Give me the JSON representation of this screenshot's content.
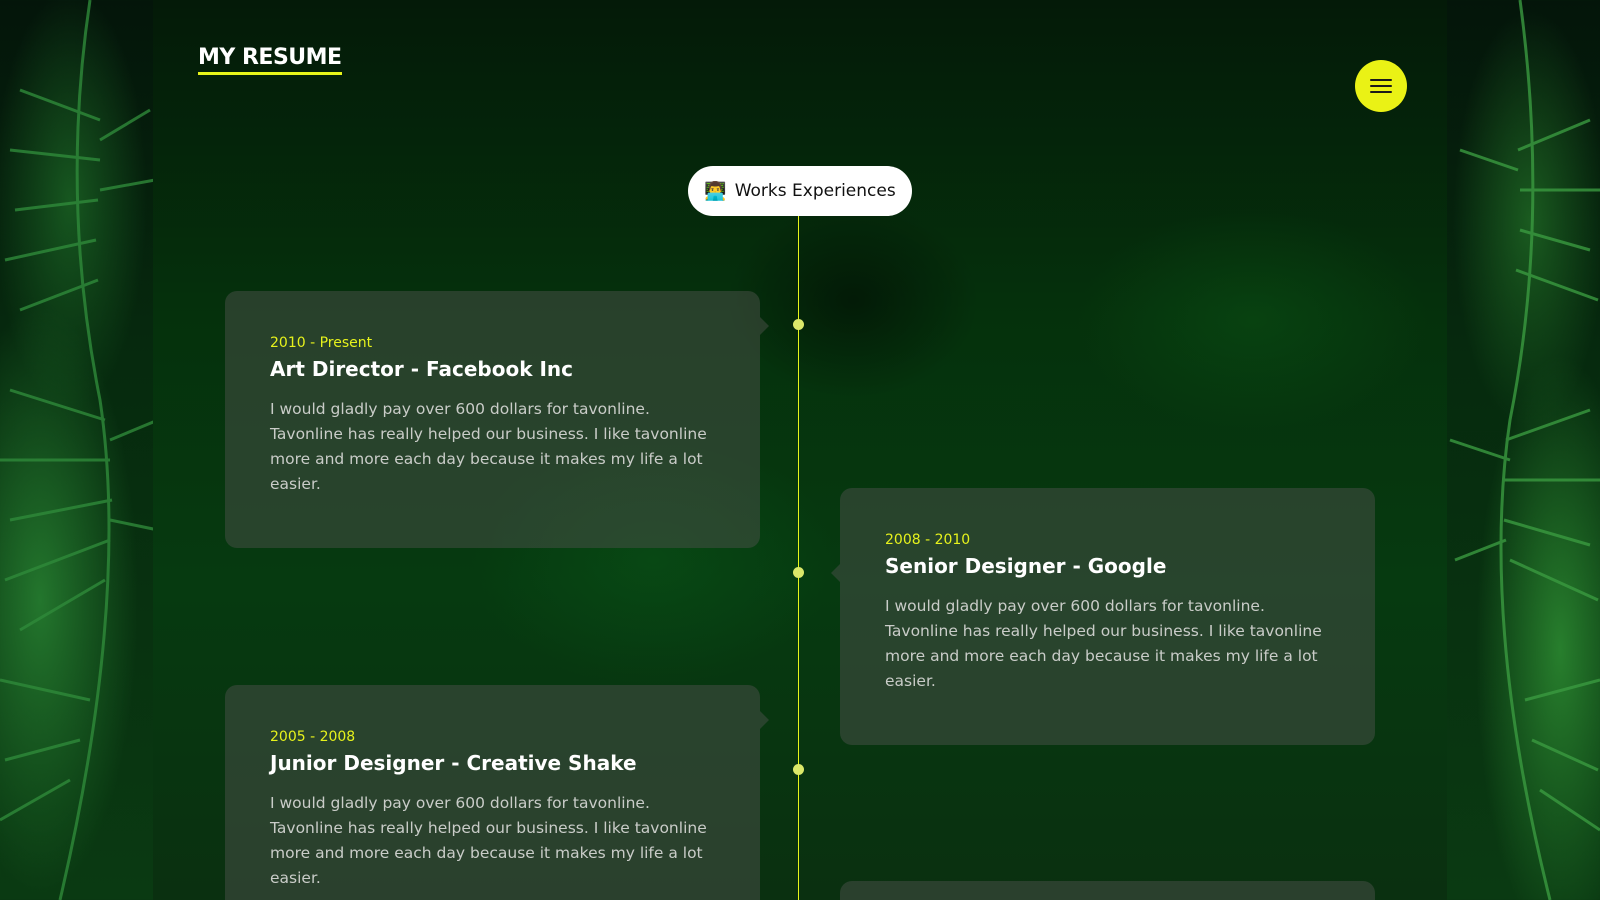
{
  "header": {
    "logo_text": "MY RESUME",
    "menu_icon": "hamburger-icon"
  },
  "section": {
    "icon": "👨‍💻",
    "title": "Works Experiences"
  },
  "experiences": [
    {
      "period": "2010 - Present",
      "role": "Art Director - Facebook Inc",
      "description": "I would gladly pay over 600 dollars for tavonline. Tavonline has really helped our business. I like tavonline more and more each day because it makes my life a lot easier."
    },
    {
      "period": "2008 - 2010",
      "role": "Senior Designer - Google",
      "description": "I would gladly pay over 600 dollars for tavonline. Tavonline has really helped our business. I like tavonline more and more each day because it makes my life a lot easier."
    },
    {
      "period": "2005 - 2008",
      "role": "Junior Designer - Creative Shake",
      "description": "I would gladly pay over 600 dollars for tavonline. Tavonline has really helped our business. I like tavonline more and more each day because it makes my life a lot easier."
    }
  ],
  "colors": {
    "accent": "#e7f51a",
    "card_bg": "#464e46",
    "background": "#063a10"
  }
}
